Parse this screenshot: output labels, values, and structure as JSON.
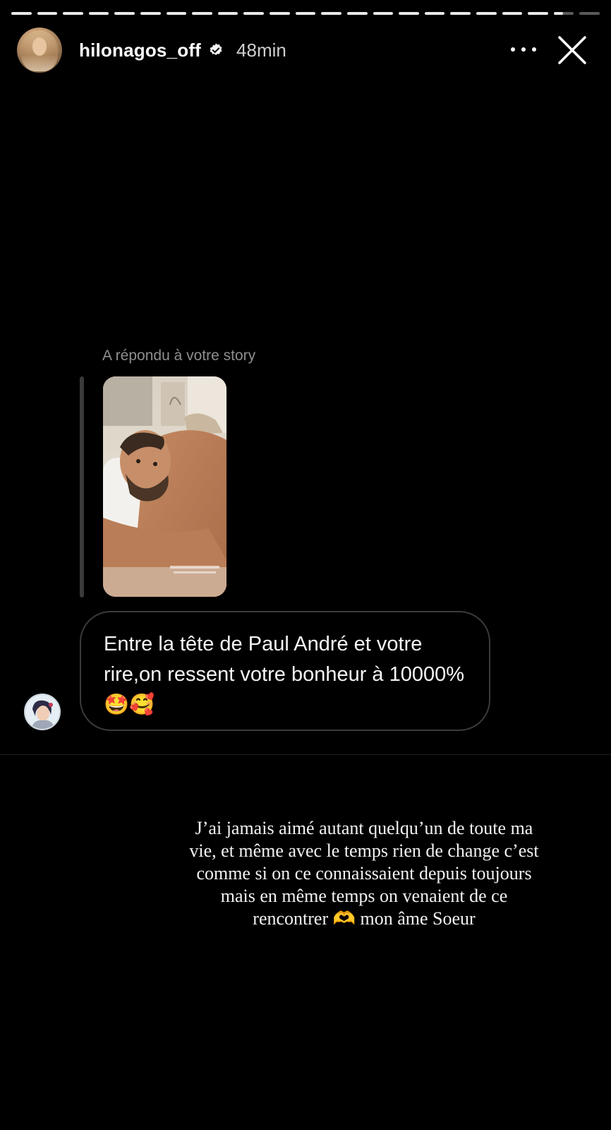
{
  "story": {
    "segment_count": 23,
    "active_segment_progress": 0.45
  },
  "header": {
    "username": "hilonagos_off",
    "time": "48min",
    "verified_icon": "verified-badge-icon",
    "more_icon": "more-horizontal-icon",
    "close_icon": "close-icon"
  },
  "reply": {
    "label": "A répondu à votre story",
    "thumbnail_icon": "story-thumbnail",
    "message": "Entre la tête de Paul André et votre rire,on ressent votre bonheur à 10000% 🤩🥰"
  },
  "caption": {
    "text": "J’ai jamais aimé autant quelqu’un de toute ma vie, et même avec le temps rien de change c’est comme si on ce connaissaient depuis toujours mais en même temps on venaient de ce rencontrer 🫶 mon âme Soeur"
  },
  "colors": {
    "background": "#000000",
    "muted_text": "#8e8e8e",
    "bubble_border": "#3b3b3b"
  }
}
